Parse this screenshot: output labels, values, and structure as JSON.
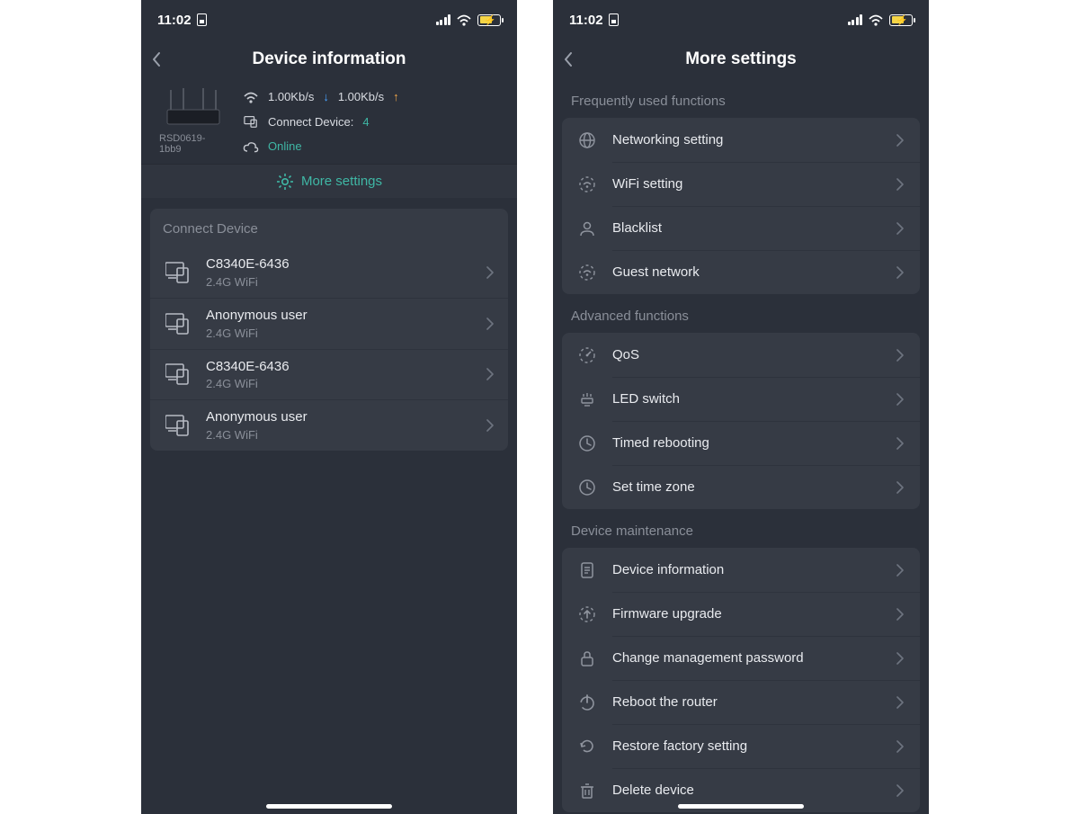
{
  "status": {
    "time": "11:02"
  },
  "screen1": {
    "title": "Device information",
    "router_id": "RSD0619-1bb9",
    "down_speed": "1.00Kb/s",
    "up_speed": "1.00Kb/s",
    "connect_label": "Connect Device:",
    "connect_count": "4",
    "online_label": "Online",
    "more_label": "More settings",
    "section_header": "Connect Device",
    "devices": [
      {
        "name": "C8340E-6436",
        "sub": "2.4G WiFi"
      },
      {
        "name": "Anonymous user",
        "sub": "2.4G WiFi"
      },
      {
        "name": "C8340E-6436",
        "sub": "2.4G WiFi"
      },
      {
        "name": "Anonymous user",
        "sub": "2.4G WiFi"
      }
    ]
  },
  "screen2": {
    "title": "More settings",
    "groups": [
      {
        "label": "Frequently used functions",
        "items": [
          {
            "icon": "globe",
            "label": "Networking setting"
          },
          {
            "icon": "wifi",
            "label": "WiFi setting"
          },
          {
            "icon": "person",
            "label": "Blacklist"
          },
          {
            "icon": "wifi",
            "label": "Guest network"
          }
        ]
      },
      {
        "label": "Advanced functions",
        "items": [
          {
            "icon": "gauge",
            "label": "QoS"
          },
          {
            "icon": "led",
            "label": "LED switch"
          },
          {
            "icon": "clock",
            "label": "Timed rebooting"
          },
          {
            "icon": "clock",
            "label": "Set time zone"
          }
        ]
      },
      {
        "label": "Device maintenance",
        "items": [
          {
            "icon": "doc",
            "label": "Device information"
          },
          {
            "icon": "upgrade",
            "label": "Firmware upgrade"
          },
          {
            "icon": "lock",
            "label": "Change management password"
          },
          {
            "icon": "power",
            "label": "Reboot the router"
          },
          {
            "icon": "restore",
            "label": "Restore factory setting"
          },
          {
            "icon": "trash",
            "label": "Delete device"
          }
        ]
      }
    ]
  }
}
